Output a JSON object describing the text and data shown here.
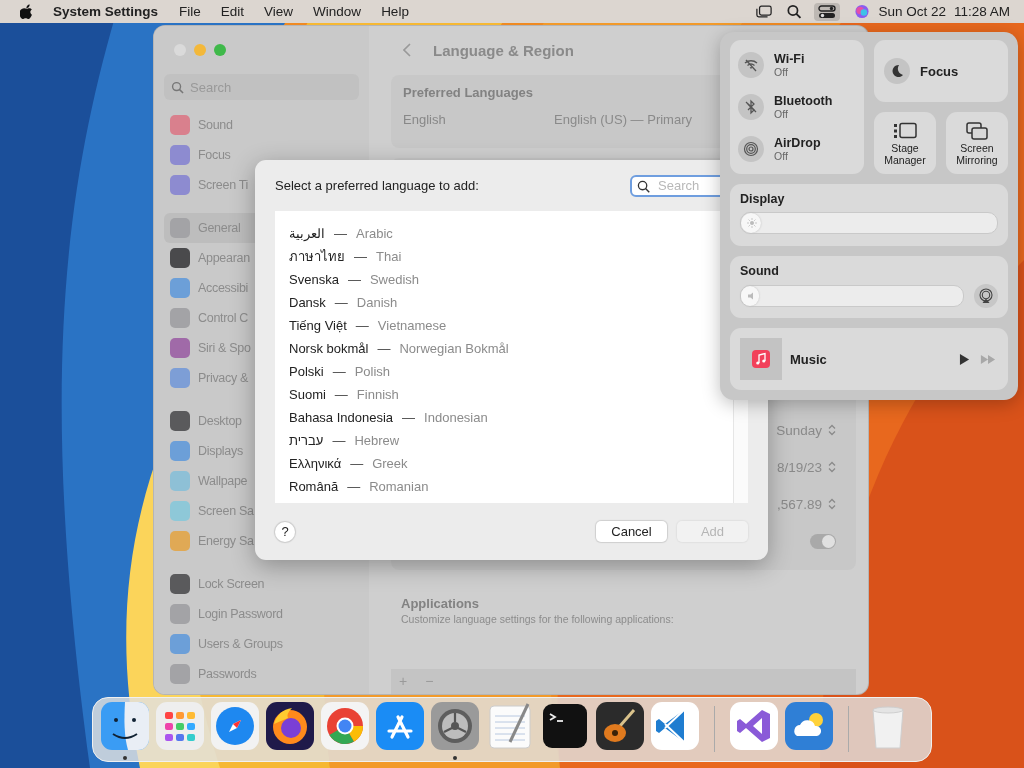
{
  "menu_bar": {
    "app_name": "System Settings",
    "menus": [
      "File",
      "Edit",
      "View",
      "Window",
      "Help"
    ],
    "date": "Sun Oct 22",
    "time": "11:28 AM"
  },
  "settings_window": {
    "search": {
      "placeholder": "Search"
    },
    "sidebar_groups": [
      [
        {
          "label": "Sound",
          "color": "#d9808d",
          "selected": false
        },
        {
          "label": "Focus",
          "color": "#8d8bd0",
          "selected": false
        },
        {
          "label": "Screen Ti",
          "color": "#8d8bd0",
          "selected": false
        }
      ],
      [
        {
          "label": "General",
          "color": "#a3a3a6",
          "selected": true
        },
        {
          "label": "Appearan",
          "color": "#4a4a4c",
          "selected": false
        },
        {
          "label": "Accessibi",
          "color": "#6c9fd8",
          "selected": false
        },
        {
          "label": "Control C",
          "color": "#a3a3a6",
          "selected": false
        },
        {
          "label": "Siri & Spo",
          "color": "#a06aa8",
          "selected": false
        },
        {
          "label": "Privacy &",
          "color": "#7d9ed6",
          "selected": false
        }
      ],
      [
        {
          "label": "Desktop",
          "color": "#5a5a5c",
          "selected": false
        },
        {
          "label": "Displays",
          "color": "#6c9fd8",
          "selected": false
        },
        {
          "label": "Wallpape",
          "color": "#8ec0d6",
          "selected": false
        },
        {
          "label": "Screen Sa",
          "color": "#8ec8d8",
          "selected": false
        },
        {
          "label": "Energy Sa",
          "color": "#e0a955",
          "selected": false
        }
      ],
      [
        {
          "label": "Lock Screen",
          "color": "#5a5a5c",
          "selected": false
        },
        {
          "label": "Login Password",
          "color": "#a3a3a6",
          "selected": false
        },
        {
          "label": "Users & Groups",
          "color": "#6c9fd8",
          "selected": false
        },
        {
          "label": "Passwords",
          "color": "#a3a3a6",
          "selected": false
        }
      ]
    ],
    "title": "Language & Region",
    "preferred_languages": {
      "heading": "Preferred Languages",
      "rows": [
        {
          "name": "English",
          "detail": "English (US) — Primary"
        }
      ]
    },
    "format_values": [
      "Sunday",
      "8/19/23",
      ",567.89"
    ],
    "toggle": {
      "on": true
    },
    "applications": {
      "heading": "Applications",
      "description": "Customize language settings for the following applications:"
    },
    "list_buttons": [
      "+",
      "−"
    ]
  },
  "dialog": {
    "prompt": "Select a preferred language to add:",
    "search": {
      "placeholder": "Search"
    },
    "languages": [
      {
        "native": "العربية",
        "separator": "—",
        "english": "Arabic"
      },
      {
        "native": "ภาษาไทย",
        "separator": "—",
        "english": "Thai"
      },
      {
        "native": "Svenska",
        "separator": "—",
        "english": "Swedish"
      },
      {
        "native": "Dansk",
        "separator": "—",
        "english": "Danish"
      },
      {
        "native": "Tiếng Việt",
        "separator": "—",
        "english": "Vietnamese"
      },
      {
        "native": "Norsk bokmål",
        "separator": "—",
        "english": "Norwegian Bokmål"
      },
      {
        "native": "Polski",
        "separator": "—",
        "english": "Polish"
      },
      {
        "native": "Suomi",
        "separator": "—",
        "english": "Finnish"
      },
      {
        "native": "Bahasa Indonesia",
        "separator": "—",
        "english": "Indonesian"
      },
      {
        "native": "עברית",
        "separator": "—",
        "english": "Hebrew"
      },
      {
        "native": "Ελληνικά",
        "separator": "—",
        "english": "Greek"
      },
      {
        "native": "Română",
        "separator": "—",
        "english": "Romanian"
      }
    ],
    "help": "?",
    "buttons": [
      {
        "label": "Cancel",
        "disabled": false
      },
      {
        "label": "Add",
        "disabled": true
      }
    ]
  },
  "control_center": {
    "toggles": [
      {
        "name": "Wi-Fi",
        "status": "Off",
        "kind": "wifi"
      },
      {
        "name": "Bluetooth",
        "status": "Off",
        "kind": "bluetooth"
      },
      {
        "name": "AirDrop",
        "status": "Off",
        "kind": "airdrop"
      }
    ],
    "focus": "Focus",
    "tiles": [
      {
        "label": "Stage Manager",
        "kind": "stage"
      },
      {
        "label": "Screen Mirroring",
        "kind": "mirror"
      }
    ],
    "display": {
      "label": "Display",
      "level": 0.05
    },
    "sound": {
      "label": "Sound",
      "level": 0.05
    },
    "now_playing": {
      "app": "Music"
    }
  },
  "dock": {
    "sections": [
      [
        {
          "kind": "finder",
          "running": true
        },
        {
          "kind": "launchpad",
          "running": false
        },
        {
          "kind": "safari",
          "running": false
        },
        {
          "kind": "firefox",
          "running": false
        },
        {
          "kind": "chrome",
          "running": false
        },
        {
          "kind": "appstore",
          "running": false
        },
        {
          "kind": "settings",
          "running": true
        },
        {
          "kind": "textedit",
          "running": false
        },
        {
          "kind": "terminal",
          "running": false
        },
        {
          "kind": "guitar",
          "running": false
        },
        {
          "kind": "vscode",
          "running": false
        }
      ],
      [
        {
          "kind": "visualstudio",
          "running": false
        },
        {
          "kind": "weather",
          "running": false
        }
      ],
      [
        {
          "kind": "trash",
          "running": false
        }
      ]
    ]
  }
}
